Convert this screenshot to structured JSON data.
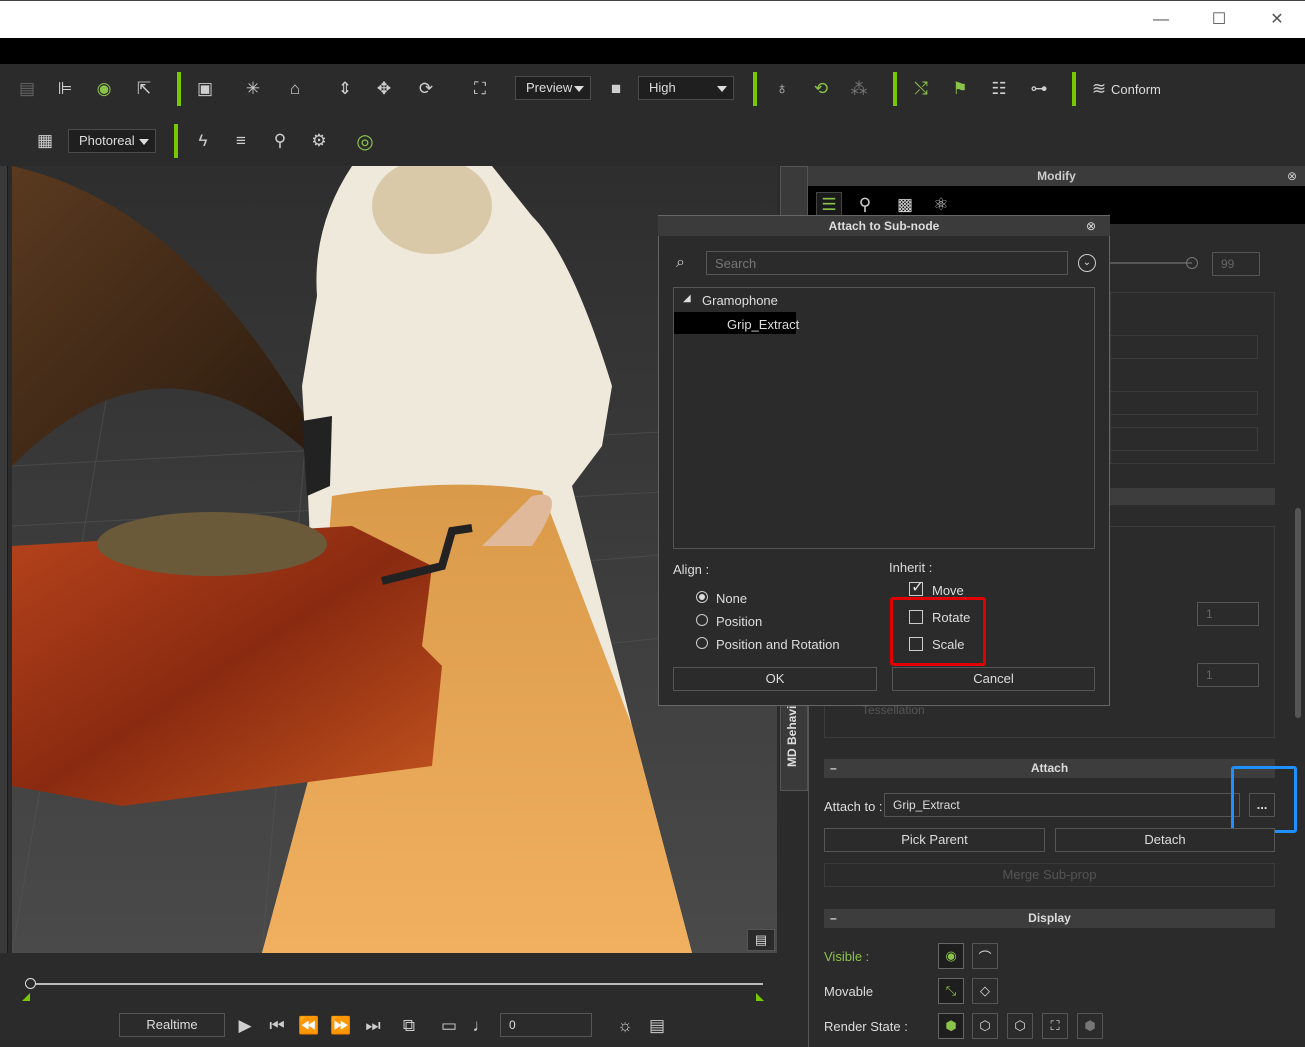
{
  "window": {
    "minimize": "—",
    "maximize": "☐",
    "close": "✕"
  },
  "toolbar1": {
    "preview_dropdown": "Preview",
    "quality_dropdown": "High",
    "conform_label": "Conform"
  },
  "toolbar2": {
    "render_dropdown": "Photoreal"
  },
  "modify_panel": {
    "title": "Modify",
    "slider_value": "99",
    "spin_value_1": "1",
    "spin_value_2": "1",
    "faded_label": "Tessellation",
    "side_tab_label": "MD Behavior",
    "attach": {
      "header": "Attach",
      "attach_to_label": "Attach to :",
      "attach_to_value": "Grip_Extract",
      "browse_button": "...",
      "pick_parent_button": "Pick Parent",
      "detach_button": "Detach",
      "merge_button": "Merge Sub-prop"
    },
    "display": {
      "header": "Display",
      "visible_label": "Visible :",
      "movable_label": "Movable",
      "render_state_label": "Render State :"
    }
  },
  "dialog": {
    "title": "Attach to Sub-node",
    "search_placeholder": "Search",
    "tree": {
      "root": "Gramophone",
      "child": "Grip_Extract"
    },
    "align": {
      "label": "Align :",
      "options": [
        "None",
        "Position",
        "Position and Rotation"
      ],
      "selected": "None"
    },
    "inherit": {
      "label": "Inherit :",
      "move": "Move",
      "rotate": "Rotate",
      "scale": "Scale",
      "move_checked": true,
      "rotate_checked": false,
      "scale_checked": false
    },
    "ok_button": "OK",
    "cancel_button": "Cancel"
  },
  "timeline": {
    "realtime_button": "Realtime",
    "frame_value": "0"
  },
  "colors": {
    "accent_green": "#78c800",
    "highlight_red": "#e00000",
    "highlight_blue": "#1e90ff"
  }
}
